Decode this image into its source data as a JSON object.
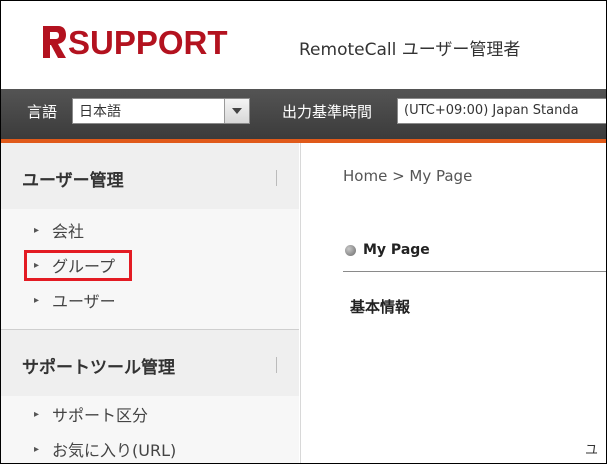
{
  "header": {
    "logo_text": "SUPPORT",
    "product_title": "RemoteCall ユーザー管理者"
  },
  "topbar": {
    "language_label": "言語",
    "language_value": "日本語",
    "timezone_label": "出力基準時間",
    "timezone_value": "(UTC+09:00) Japan Standa"
  },
  "sidebar": {
    "user_management": {
      "title": "ユーザー管理",
      "items": [
        "会社",
        "グループ",
        "ユーザー"
      ]
    },
    "support_tool_management": {
      "title": "サポートツール管理",
      "items": [
        "サポート区分",
        "お気に入り(URL)"
      ]
    }
  },
  "main": {
    "breadcrumb": "Home > My Page",
    "page_title": "My Page",
    "section_basic": "基本情報",
    "corner_text": "ユ"
  },
  "colors": {
    "brand_red": "#b3121f",
    "accent_orange": "#e05a1a",
    "highlight_red": "#e31b23"
  }
}
